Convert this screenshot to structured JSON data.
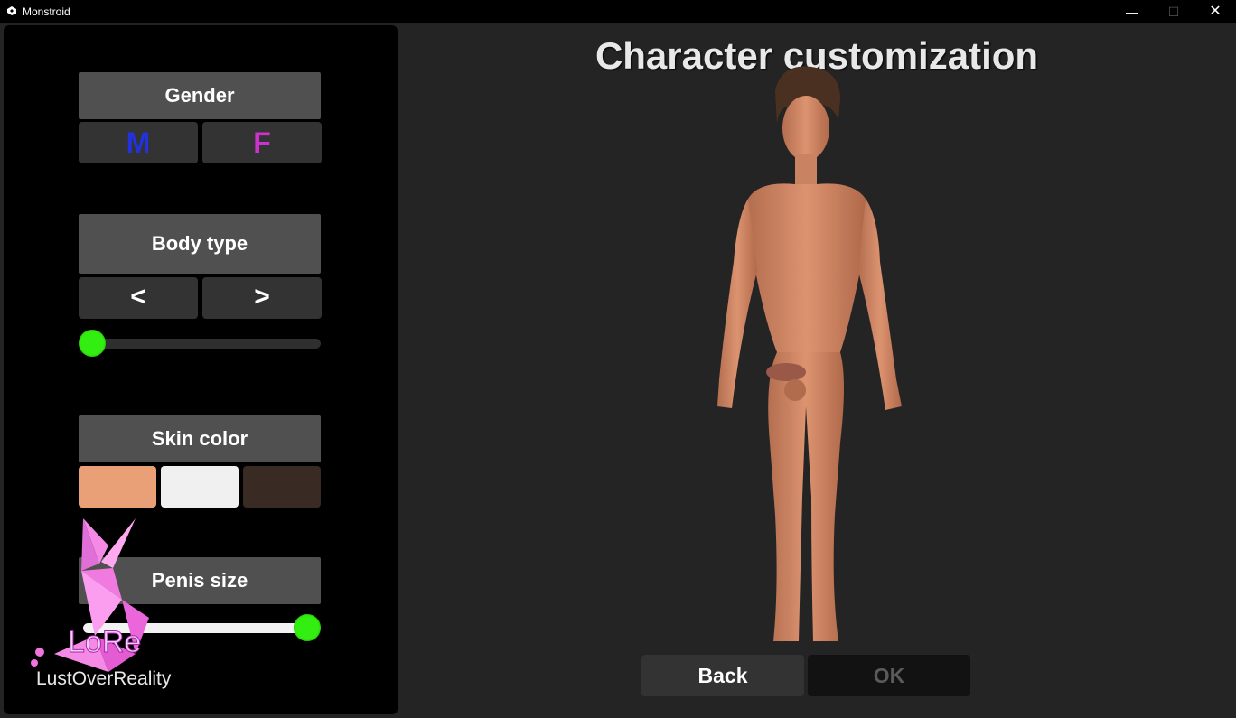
{
  "window": {
    "title": "Monstroid",
    "minimize": "—",
    "maximize": "☐",
    "close": "✕"
  },
  "screen_title": "Character customization",
  "gender": {
    "label": "Gender",
    "male": "M",
    "female": "F",
    "male_color": "#2233dd",
    "female_color": "#cc33cc"
  },
  "body_type": {
    "label": "Body type",
    "prev": "<",
    "next": ">",
    "slider_value": 0
  },
  "skin_color": {
    "label": "Skin color",
    "swatches": [
      "#e9a077",
      "#f0f0f0",
      "#3a2a24"
    ]
  },
  "penis_size": {
    "label": "Penis size",
    "slider_value": 1
  },
  "buttons": {
    "back": "Back",
    "ok": "OK"
  },
  "watermark": {
    "logo_text": "LoRe",
    "caption": "LustOverReality"
  }
}
